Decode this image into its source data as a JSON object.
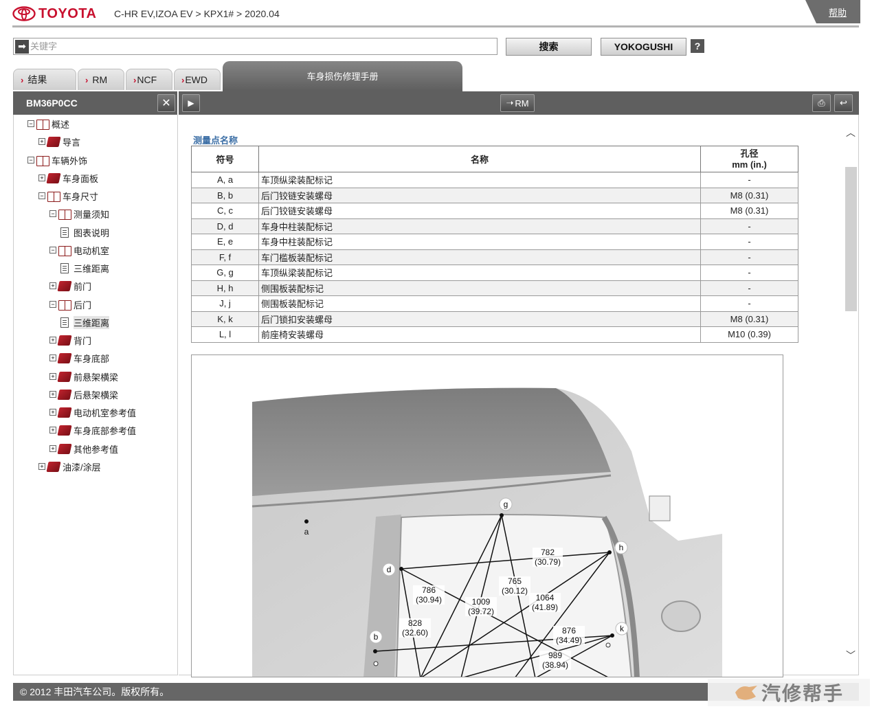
{
  "header": {
    "brand": "TOYOTA",
    "breadcrumb": "C-HR EV,IZOA EV > KPX1# > 2020.04",
    "help": "帮助"
  },
  "search": {
    "placeholder": "关键字",
    "search_button": "搜索",
    "yoko_button": "YOKOGUSHI",
    "help_icon": "?"
  },
  "tabs": [
    {
      "label": "结果"
    },
    {
      "label": "RM"
    },
    {
      "label": "NCF"
    },
    {
      "label": "EWD"
    }
  ],
  "active_tab": "车身损伤修理手册",
  "left_panel": {
    "title": "BM36P0CC"
  },
  "toolbar": {
    "rm_button": "RM"
  },
  "tree": [
    {
      "label": "概述",
      "toggle": "−",
      "icon": "book-open-icon"
    },
    {
      "label": "导言",
      "toggle": "+",
      "icon": "book-icon"
    },
    {
      "label": "车辆外饰",
      "toggle": "−",
      "icon": "book-open-icon"
    },
    {
      "label": "车身面板",
      "toggle": "+",
      "icon": "book-icon"
    },
    {
      "label": "车身尺寸",
      "toggle": "−",
      "icon": "book-open-icon"
    },
    {
      "label": "测量须知",
      "toggle": "−",
      "icon": "book-open-icon"
    },
    {
      "label": "图表说明",
      "toggle": "",
      "icon": "document-icon"
    },
    {
      "label": "电动机室",
      "toggle": "−",
      "icon": "book-open-icon"
    },
    {
      "label": "三维距离",
      "toggle": "",
      "icon": "document-icon"
    },
    {
      "label": "前门",
      "toggle": "+",
      "icon": "book-icon"
    },
    {
      "label": "后门",
      "toggle": "−",
      "icon": "book-open-icon"
    },
    {
      "label": "三维距离",
      "toggle": "",
      "icon": "document-icon",
      "selected": true
    },
    {
      "label": "背门",
      "toggle": "+",
      "icon": "book-icon"
    },
    {
      "label": "车身底部",
      "toggle": "+",
      "icon": "book-icon"
    },
    {
      "label": "前悬架横梁",
      "toggle": "+",
      "icon": "book-icon"
    },
    {
      "label": "后悬架横梁",
      "toggle": "+",
      "icon": "book-icon"
    },
    {
      "label": "电动机室参考值",
      "toggle": "+",
      "icon": "book-icon"
    },
    {
      "label": "车身底部参考值",
      "toggle": "+",
      "icon": "book-icon"
    },
    {
      "label": "其他参考值",
      "toggle": "+",
      "icon": "book-icon"
    },
    {
      "label": "油漆/涂层",
      "toggle": "+",
      "icon": "book-icon"
    }
  ],
  "content": {
    "section_title": "测量点名称",
    "table": {
      "headers": {
        "symbol": "符号",
        "name": "名称",
        "diameter_line1": "孔径",
        "diameter_line2": "mm (in.)"
      },
      "rows": [
        {
          "symbol": "A, a",
          "name": "车顶纵梁装配标记",
          "diameter": "-"
        },
        {
          "symbol": "B, b",
          "name": "后门铰链安装螺母",
          "diameter": "M8 (0.31)"
        },
        {
          "symbol": "C, c",
          "name": "后门铰链安装螺母",
          "diameter": "M8 (0.31)"
        },
        {
          "symbol": "D, d",
          "name": "车身中柱装配标记",
          "diameter": "-"
        },
        {
          "symbol": "E, e",
          "name": "车身中柱装配标记",
          "diameter": "-"
        },
        {
          "symbol": "F, f",
          "name": "车门槛板装配标记",
          "diameter": "-"
        },
        {
          "symbol": "G, g",
          "name": "车顶纵梁装配标记",
          "diameter": "-"
        },
        {
          "symbol": "H, h",
          "name": "侧围板装配标记",
          "diameter": "-"
        },
        {
          "symbol": "J, j",
          "name": "侧围板装配标记",
          "diameter": "-"
        },
        {
          "symbol": "K, k",
          "name": "后门锁扣安装螺母",
          "diameter": "M8 (0.31)"
        },
        {
          "symbol": "L, l",
          "name": "前座椅安装螺母",
          "diameter": "M10 (0.39)"
        }
      ]
    },
    "figure": {
      "points": [
        "a",
        "b",
        "d",
        "g",
        "h",
        "k"
      ],
      "dimensions": [
        {
          "mm": "782",
          "in": "(30.79)"
        },
        {
          "mm": "786",
          "in": "(30.94)"
        },
        {
          "mm": "765",
          "in": "(30.12)"
        },
        {
          "mm": "1009",
          "in": "(39.72)"
        },
        {
          "mm": "1064",
          "in": "(41.89)"
        },
        {
          "mm": "828",
          "in": "(32.60)"
        },
        {
          "mm": "876",
          "in": "(34.49)"
        },
        {
          "mm": "989",
          "in": "(38.94)"
        }
      ]
    }
  },
  "footer": {
    "copyright": "© 2012 丰田汽车公司。版权所有。"
  },
  "watermark": {
    "text": "汽修帮手"
  },
  "colors": {
    "brand_red": "#c8102e",
    "bar_gray": "#5f5f5f",
    "section_blue": "#3b6ea5"
  }
}
